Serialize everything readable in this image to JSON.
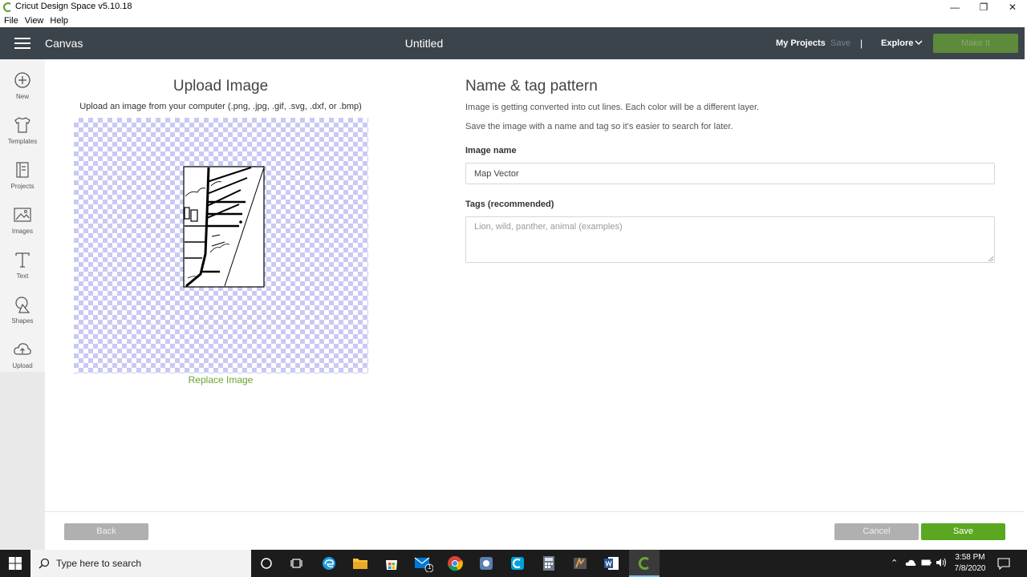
{
  "window": {
    "title": "Cricut Design Space  v5.10.18",
    "menu": [
      "File",
      "View",
      "Help"
    ]
  },
  "header": {
    "section": "Canvas",
    "doc_title": "Untitled",
    "my_projects": "My Projects",
    "save": "Save",
    "separator": "|",
    "explore": "Explore",
    "make_it": "Make It"
  },
  "sidebar": {
    "items": [
      {
        "label": "New",
        "icon": "plus-circle-icon"
      },
      {
        "label": "Templates",
        "icon": "tshirt-icon"
      },
      {
        "label": "Projects",
        "icon": "projects-icon"
      },
      {
        "label": "Images",
        "icon": "image-icon"
      },
      {
        "label": "Text",
        "icon": "text-icon"
      },
      {
        "label": "Shapes",
        "icon": "shapes-icon"
      },
      {
        "label": "Upload",
        "icon": "cloud-upload-icon"
      }
    ]
  },
  "upload": {
    "title": "Upload Image",
    "subtitle": "Upload an image from your computer (.png, .jpg, .gif, .svg, .dxf, or .bmp)",
    "replace": "Replace Image"
  },
  "form": {
    "title": "Name & tag pattern",
    "desc1": "Image is getting converted into cut lines. Each color will be a different layer.",
    "desc2": "Save the image with a name and tag so it's easier to search for later.",
    "name_label": "Image name",
    "name_value": "Map Vector",
    "tags_label": "Tags (recommended)",
    "tags_placeholder": "Lion, wild, panther, animal (examples)"
  },
  "footer": {
    "back": "Back",
    "cancel": "Cancel",
    "save": "Save"
  },
  "taskbar": {
    "search_placeholder": "Type here to search",
    "time": "3:58 PM",
    "date": "7/8/2020",
    "mail_badge": "1"
  },
  "colors": {
    "header_bg": "#3b444b",
    "accent_green": "#5aa81f",
    "link_green": "#6aa334"
  }
}
